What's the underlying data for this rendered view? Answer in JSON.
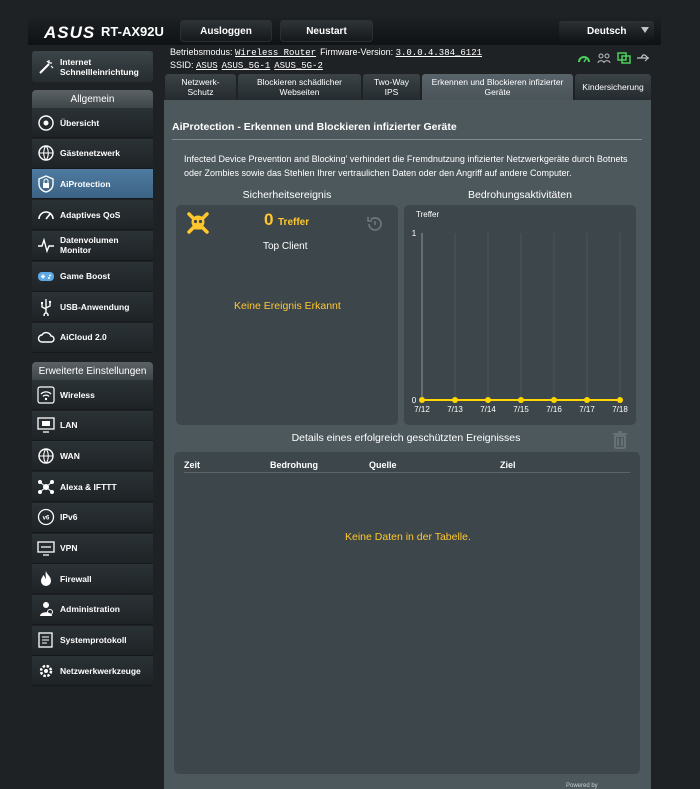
{
  "header": {
    "brand": "ASUS",
    "model": "RT-AX92U",
    "logout_label": "Ausloggen",
    "restart_label": "Neustart",
    "language": "Deutsch"
  },
  "info": {
    "mode_label": "Betriebsmodus:",
    "mode_value": "Wireless Router",
    "firmware_label": "Firmware-Version:",
    "firmware_value": "3.0.0.4.384_6121",
    "ssid_label": "SSID:",
    "ssids": [
      "ASUS",
      "ASUS_5G-1",
      "ASUS_5G-2"
    ]
  },
  "sidebar": {
    "quick": "Internet Schnellleinrichtung",
    "general_title": "Allgemein",
    "general": [
      {
        "label": "Übersicht",
        "icon": "map-icon"
      },
      {
        "label": "Gästenetzwerk",
        "icon": "globe-icon"
      },
      {
        "label": "AiProtection",
        "icon": "lock-shield-icon"
      },
      {
        "label": "Adaptives QoS",
        "icon": "gauge-icon"
      },
      {
        "label": "Datenvolumen Monitor",
        "icon": "pulse-icon"
      },
      {
        "label": "Game Boost",
        "icon": "gamepad-icon"
      },
      {
        "label": "USB-Anwendung",
        "icon": "usb-icon"
      },
      {
        "label": "AiCloud 2.0",
        "icon": "cloud-icon"
      }
    ],
    "advanced_title": "Erweiterte Einstellungen",
    "advanced": [
      {
        "label": "Wireless",
        "icon": "wifi-icon"
      },
      {
        "label": "LAN",
        "icon": "lan-icon"
      },
      {
        "label": "WAN",
        "icon": "globe-icon"
      },
      {
        "label": "Alexa & IFTTT",
        "icon": "network-icon"
      },
      {
        "label": "IPv6",
        "icon": "ipv6-icon"
      },
      {
        "label": "VPN",
        "icon": "vpn-icon"
      },
      {
        "label": "Firewall",
        "icon": "fire-icon"
      },
      {
        "label": "Administration",
        "icon": "admin-icon"
      },
      {
        "label": "Systemprotokoll",
        "icon": "log-icon"
      },
      {
        "label": "Netzwerkwerkzeuge",
        "icon": "tools-icon"
      }
    ]
  },
  "tabs": [
    {
      "label": "Netzwerk-Schutz"
    },
    {
      "label": "Blockieren schädlicher Webseiten"
    },
    {
      "label": "Two-Way IPS"
    },
    {
      "label": "Erkennen und Blockieren infizierter Geräte"
    },
    {
      "label": "Kindersicherung"
    }
  ],
  "page": {
    "title": "AiProtection - Erkennen und Blockieren infizierter Geräte",
    "description": "Infected Device Prevention and Blocking' verhindert die Fremdnutzung infizierter Netzwerkgeräte durch Botnets oder Zombies sowie das Stehlen Ihrer vertraulichen Daten oder den Angriff auf andere Computer.",
    "security_title": "Sicherheitsereignis",
    "threat_title": "Bedrohungsaktivitäten",
    "hit_count": "0",
    "hit_label": "Treffer",
    "top_client": "Top Client",
    "no_event": "Keine Ereignis Erkannt",
    "details_title": "Details eines erfolgreich geschützten Ereignisses",
    "columns": [
      "Zeit",
      "Bedrohung",
      "Quelle",
      "Ziel"
    ],
    "no_data": "Keine Daten in der Tabelle.",
    "powered": "Powered by"
  },
  "chart_data": {
    "type": "line",
    "ylabel": "Treffer",
    "categories": [
      "7/12",
      "7/13",
      "7/14",
      "7/15",
      "7/16",
      "7/17",
      "7/18"
    ],
    "values": [
      0,
      0,
      0,
      0,
      0,
      0,
      0
    ],
    "yticks": [
      0,
      1
    ],
    "ylim": [
      0,
      1
    ],
    "color": "#ffd600",
    "grid": "vertical"
  }
}
